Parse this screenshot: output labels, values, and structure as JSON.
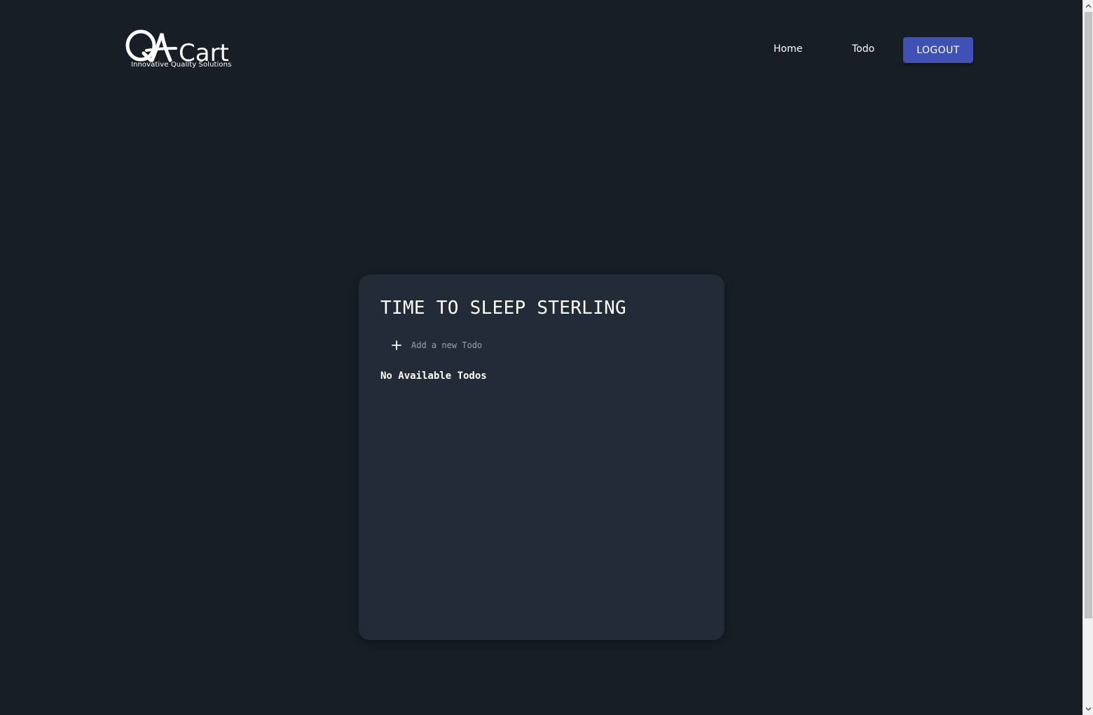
{
  "header": {
    "logo": {
      "wordmark": "QACart",
      "tagline": "Innovative Quality Solutions"
    },
    "nav": [
      {
        "label": "Home"
      },
      {
        "label": "Todo"
      }
    ],
    "logout_label": "LOGOUT"
  },
  "card": {
    "title": "TIME TO SLEEP STERLING",
    "add_placeholder": "Add a new Todo",
    "add_value": "",
    "empty_message": "No Available Todos"
  },
  "colors": {
    "background": "#181e26",
    "card": "#222b36",
    "accent": "#3f51b5"
  },
  "icons": [
    "plus-icon",
    "scroll-up-arrow-icon",
    "scroll-down-arrow-icon"
  ]
}
